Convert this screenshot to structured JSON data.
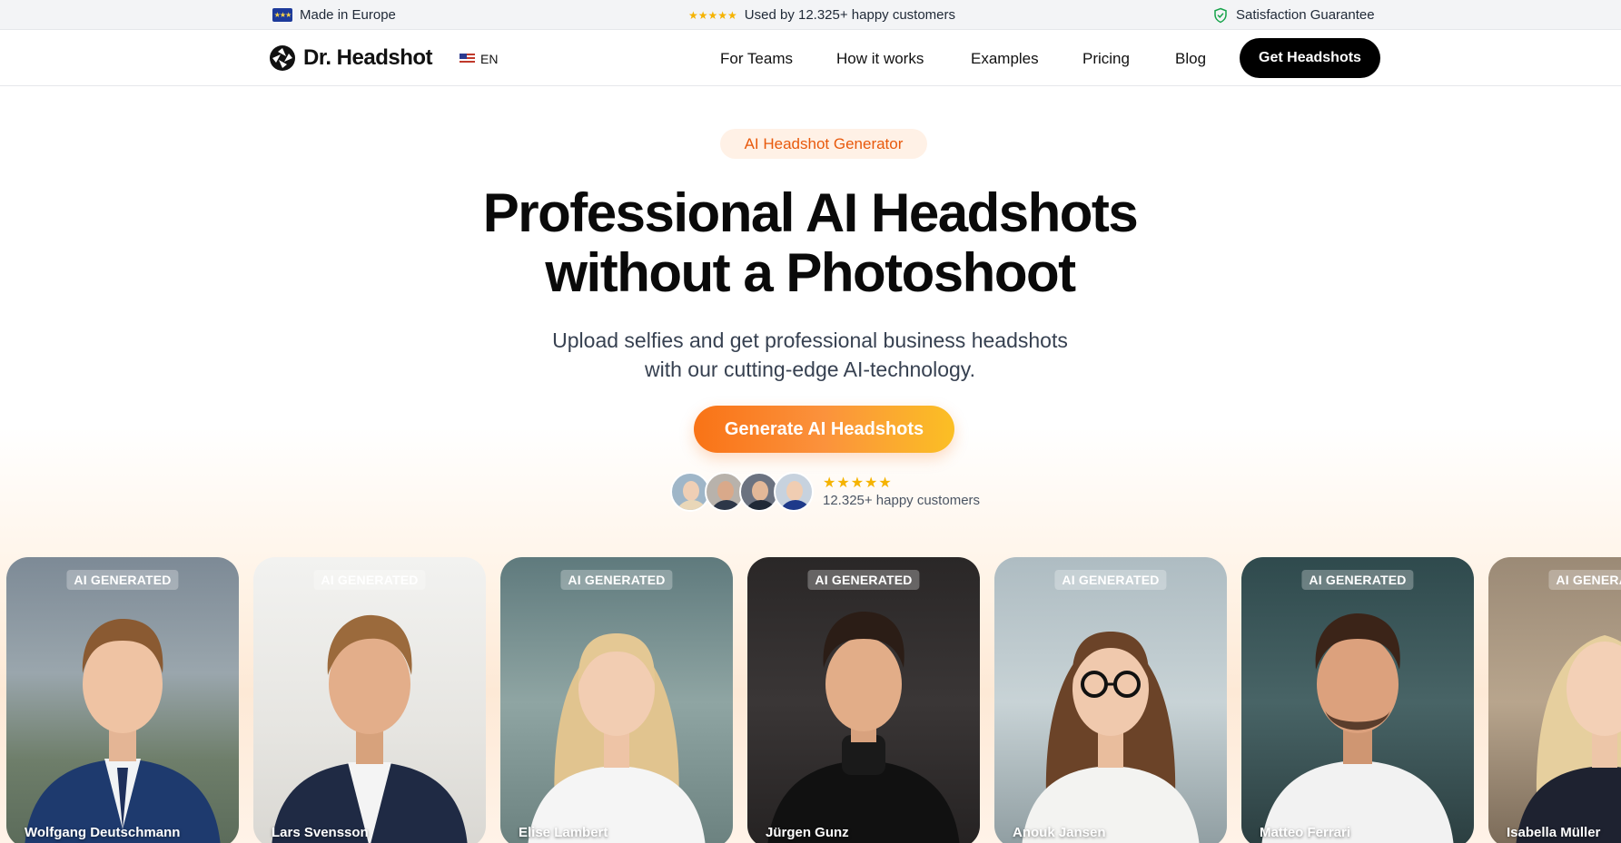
{
  "topbar": {
    "made_in": "Made in Europe",
    "customers": "Used by 12.325+ happy customers",
    "guarantee": "Satisfaction Guarantee"
  },
  "nav": {
    "logo": "Dr. Headshot",
    "lang": "EN",
    "links": [
      "For Teams",
      "How it works",
      "Examples",
      "Pricing",
      "Blog"
    ],
    "cta": "Get Headshots"
  },
  "hero": {
    "badge": "AI Headshot Generator",
    "title_line1": "Professional AI Headshots",
    "title_line2": "without a Photoshoot",
    "subtitle_line1": "Upload selfies and get professional business headshots",
    "subtitle_line2": "with our cutting-edge AI-technology.",
    "cta": "Generate AI Headshots",
    "rating": 5,
    "rating_text": "12.325+ happy customers"
  },
  "cards": {
    "tag": "AI GENERATED",
    "names": [
      "Wolfgang Deutschmann",
      "Lars Svensson",
      "Elise Lambert",
      "Jürgen Gunz",
      "Anouk Jansen",
      "Matteo Ferrari",
      "Isabella Müller"
    ]
  },
  "colors": {
    "accent": "#f97316",
    "accent_end": "#fbbf24",
    "badge_text": "#e8590c",
    "cta_dark": "#000000"
  }
}
